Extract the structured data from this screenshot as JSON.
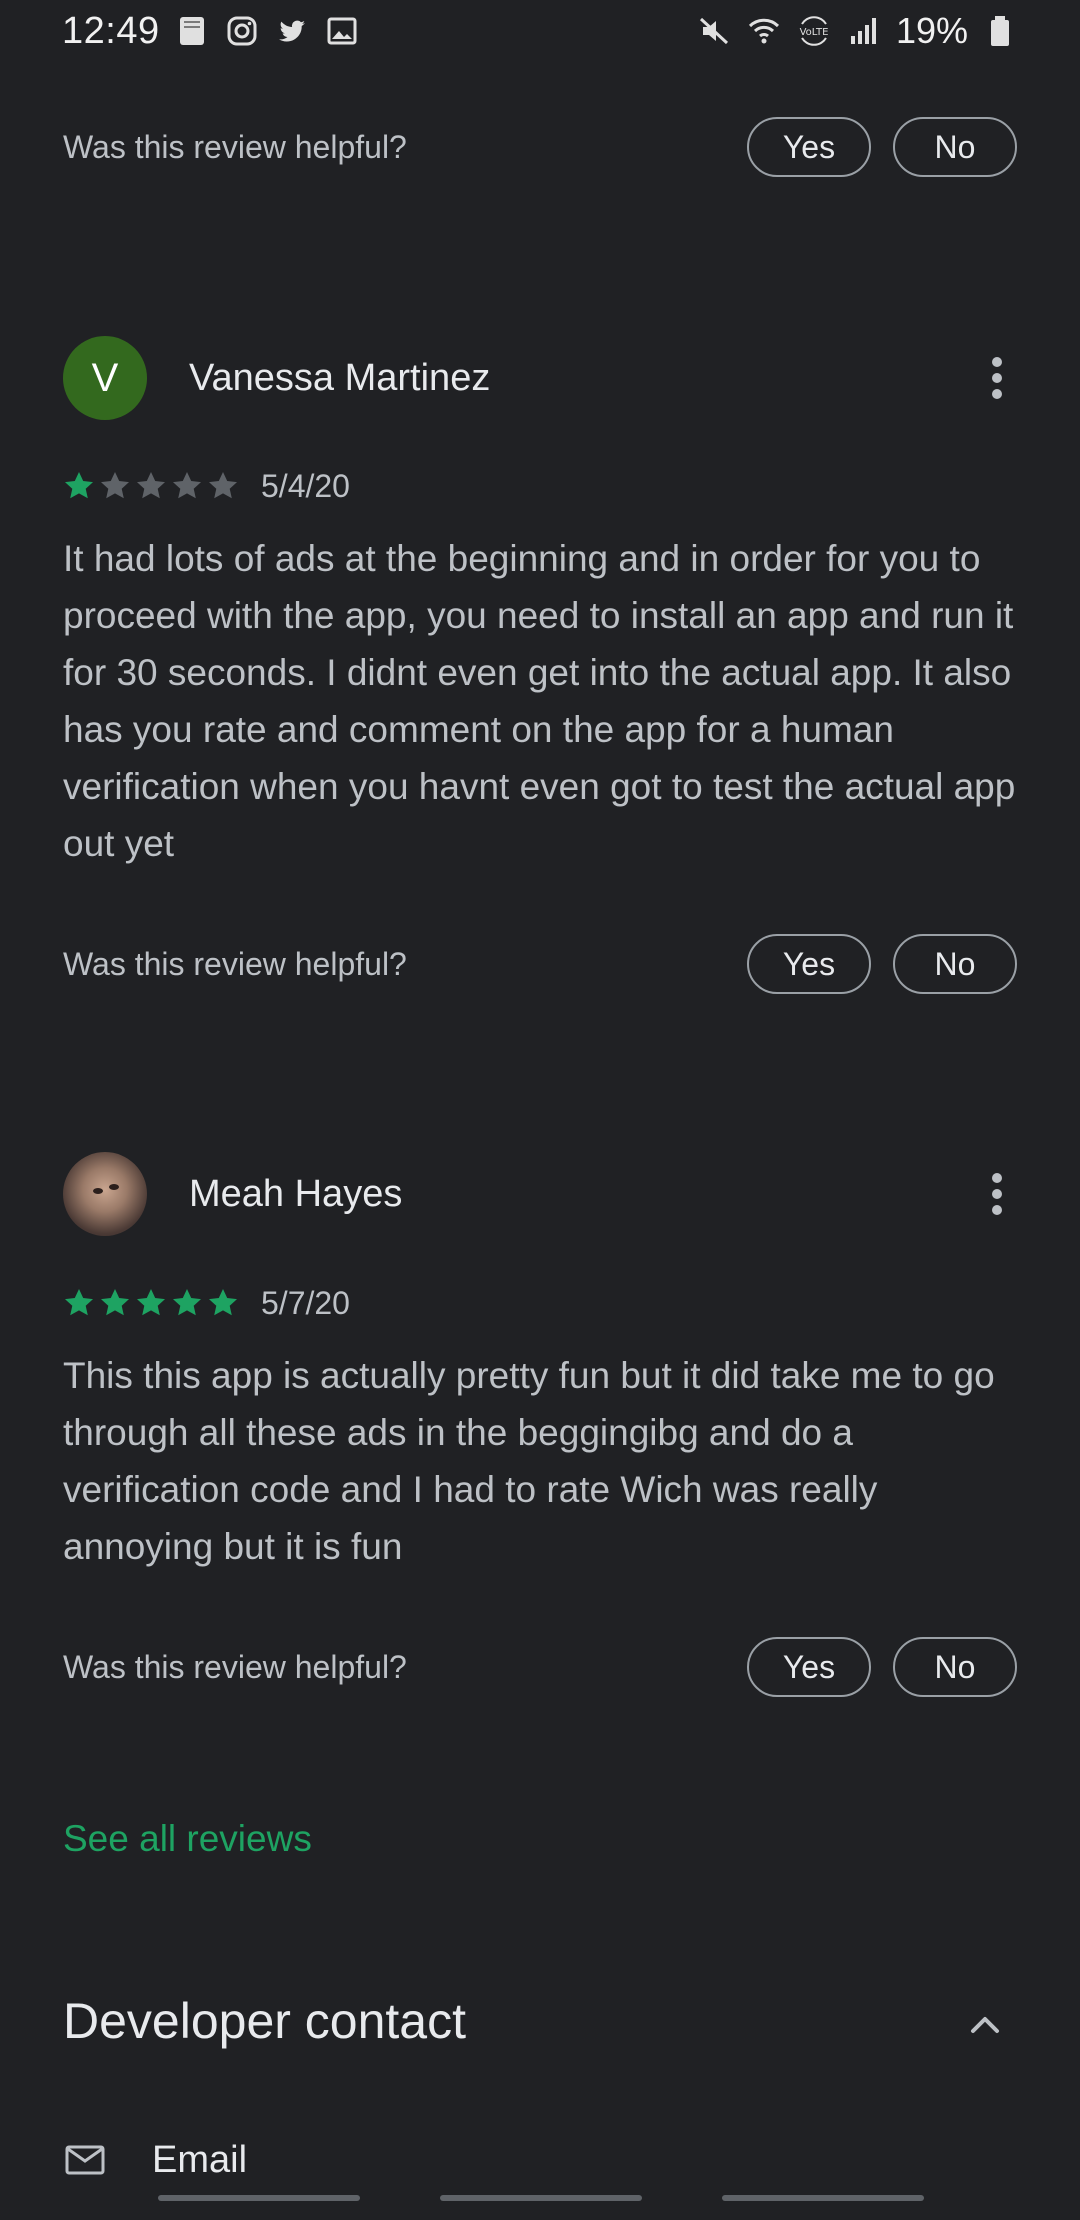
{
  "status_bar": {
    "time": "12:49",
    "battery": "19%"
  },
  "helpful": {
    "question": "Was this review helpful?",
    "yes": "Yes",
    "no": "No"
  },
  "reviews": [
    {
      "avatar_letter": "V",
      "name": "Vanessa Martinez",
      "rating": 1,
      "date": "5/4/20",
      "text": "It had lots of ads at the beginning and in order for you to proceed with the app, you need to install an app and run it for 30 seconds. I didnt even get into the actual app. It also has you rate and comment on the app for a human verification when you havnt even got to test the actual app out yet"
    },
    {
      "avatar_letter": "",
      "name": "Meah Hayes",
      "rating": 5,
      "date": "5/7/20",
      "text": "This this app is actually pretty fun but it did take me to go through all these ads in the beggingibg and do a verification code and I had to rate Wich was really annoying but it is fun"
    }
  ],
  "see_all_label": "See all reviews",
  "developer_contact": {
    "title": "Developer contact",
    "email_label": "Email"
  },
  "colors": {
    "background": "#202124",
    "accent_green": "#1ea362",
    "star_empty": "#5f6368"
  }
}
